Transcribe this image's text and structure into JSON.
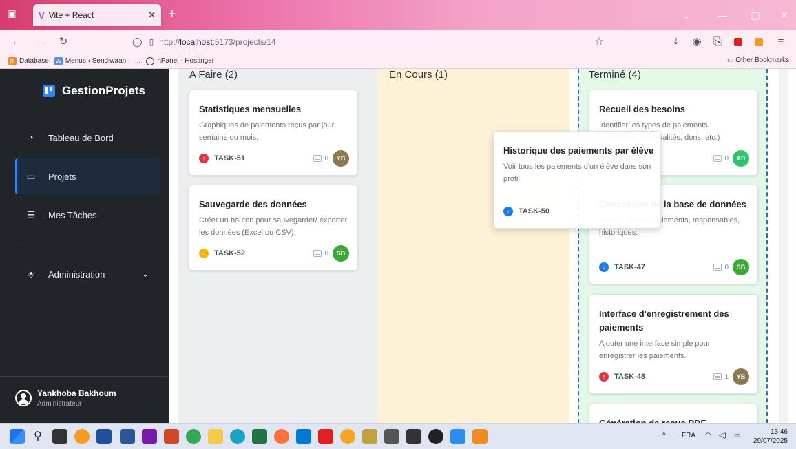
{
  "browser": {
    "tab_title": "Vite + React",
    "url_prefix": "http://",
    "url_host": "localhost",
    "url_rest": ":5173/projects/14",
    "bookmarks": [
      "Database",
      "Menus ‹ Sendiwaan —...",
      "hPanel - Hostinger"
    ],
    "other_bookmarks": "Other Bookmarks"
  },
  "sidebar": {
    "brand": "GestionProjets",
    "items": [
      {
        "label": "Tableau de Bord",
        "icon": "dashboard-icon"
      },
      {
        "label": "Projets",
        "icon": "folder-icon"
      },
      {
        "label": "Mes Tâches",
        "icon": "list-icon"
      },
      {
        "label": "Administration",
        "icon": "shield-icon"
      }
    ],
    "user": {
      "name": "Yankhoba Bakhoum",
      "role": "Administrateur"
    }
  },
  "columns": {
    "todo": {
      "title": "A Faire (2)",
      "cards": [
        {
          "title": "Statistiques mensuelles",
          "desc": "Graphiques de paiements reçus par jour, semaine ou mois.",
          "priority": "high",
          "id": "TASK-51",
          "comments": "0",
          "assignee": "YB",
          "assignee_color": "#8a7a4f"
        },
        {
          "title": "Sauvegarde des données",
          "desc": "Créer un bouton pour sauvegarder/ exporter les données (Excel ou CSV).",
          "priority": "medium",
          "id": "TASK-52",
          "comments": "0",
          "assignee": "SB",
          "assignee_color": "#3aa935"
        }
      ]
    },
    "in_progress": {
      "title": "En Cours (1)"
    },
    "done": {
      "title": "Terminé (4)",
      "cards": [
        {
          "title": "Recueil des besoins",
          "desc": "Identifier les types de paiements (inscription, mensualités, dons, etc.)",
          "priority": "medium",
          "id": "TASK-46",
          "comments": "0",
          "assignee": "AD",
          "assignee_color": "#2fc46b"
        },
        {
          "title": "Conception de la base de données",
          "desc": "Tables : élèves, paiements, responsables, historiques.",
          "priority": "low",
          "id": "TASK-47",
          "comments": "0",
          "assignee": "SB",
          "assignee_color": "#3aa935"
        },
        {
          "title": "Interface d'enregistrement des paiements",
          "desc": "Ajouter une interface simple pour enregistrer les paiements.",
          "priority": "high",
          "id": "TASK-48",
          "comments": "1",
          "assignee": "YB",
          "assignee_color": "#8a7a4f"
        },
        {
          "title": "Génération de reçus PDF"
        }
      ]
    }
  },
  "dragging_card": {
    "title": "Historique des paiements par élève",
    "desc": "Voir tous les paiements d'un élève dans son profil.",
    "priority": "low",
    "id": "TASK-50"
  },
  "taskbar": {
    "lang": "FRA",
    "time": "13:46",
    "date": "29/07/2025"
  }
}
